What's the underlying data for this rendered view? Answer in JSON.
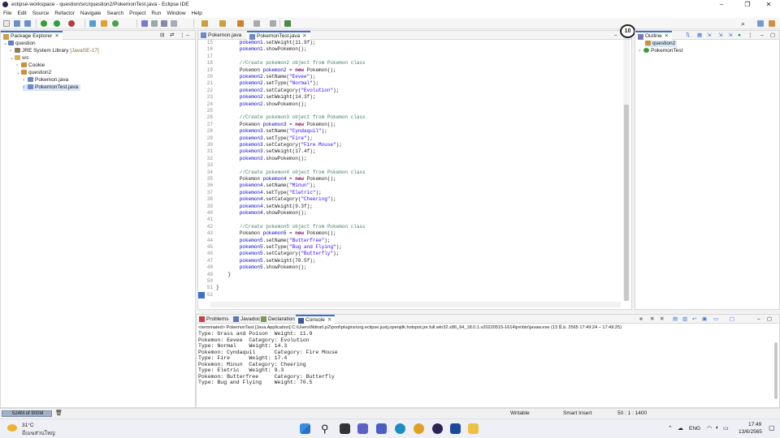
{
  "window": {
    "title": "eclipse-workspace - question/src/question2/PokemonTest.java - Eclipse IDE"
  },
  "menu": [
    "File",
    "Edit",
    "Source",
    "Refactor",
    "Navigate",
    "Search",
    "Project",
    "Run",
    "Window",
    "Help"
  ],
  "package_explorer": {
    "title": "Package Explorer",
    "items": [
      {
        "label": "question"
      },
      {
        "label": "JRE System Library",
        "suffix": "[JavaSE-17]"
      },
      {
        "label": "src"
      },
      {
        "label": "Cookie"
      },
      {
        "label": "question2"
      },
      {
        "label": "Pokemon.java"
      },
      {
        "label": "PokemonTest.java"
      }
    ]
  },
  "editor": {
    "tabs": [
      {
        "label": "Pokemon.java"
      },
      {
        "label": "PokemonTest.java"
      }
    ],
    "badge": "10",
    "lines": [
      {
        "n": "15",
        "t": "        pokemon1.setWeight(11.9f);"
      },
      {
        "n": "16",
        "t": "        pokemon1.showPokemon();"
      },
      {
        "n": "17",
        "t": ""
      },
      {
        "n": "18",
        "t": "        //Create pokemon2 object from Pokemon class"
      },
      {
        "n": "19",
        "t": "        Pokemon pokemon2 = new Pokemon();"
      },
      {
        "n": "20",
        "t": "        pokemon2.setName(\"Eevee\");"
      },
      {
        "n": "21",
        "t": "        pokemon2.setType(\"Normal\");"
      },
      {
        "n": "22",
        "t": "        pokemon2.setCategory(\"Evolution\");"
      },
      {
        "n": "23",
        "t": "        pokemon2.setWeight(14.3f);"
      },
      {
        "n": "24",
        "t": "        pokemon2.showPokemon();"
      },
      {
        "n": "25",
        "t": ""
      },
      {
        "n": "26",
        "t": "        //Create pokemon3 object from Pokemon class"
      },
      {
        "n": "27",
        "t": "        Pokemon pokemon3 = new Pokemon();"
      },
      {
        "n": "28",
        "t": "        pokemon3.setName(\"Cyndaquil\");"
      },
      {
        "n": "29",
        "t": "        pokemon3.setType(\"Fire\");"
      },
      {
        "n": "30",
        "t": "        pokemon3.setCategory(\"Fire Mouse\");"
      },
      {
        "n": "31",
        "t": "        pokemon3.setWeight(17.4f);"
      },
      {
        "n": "32",
        "t": "        pokemon3.showPokemon();"
      },
      {
        "n": "33",
        "t": ""
      },
      {
        "n": "34",
        "t": "        //Create pokemon4 object from Pokemon class"
      },
      {
        "n": "35",
        "t": "        Pokemon pokemon4 = new Pokemon();"
      },
      {
        "n": "36",
        "t": "        pokemon4.setName(\"Minun\");"
      },
      {
        "n": "37",
        "t": "        pokemon4.setType(\"Eletric\");"
      },
      {
        "n": "38",
        "t": "        pokemon4.setCategory(\"Cheering\");"
      },
      {
        "n": "39",
        "t": "        pokemon4.setWeight(9.3f);"
      },
      {
        "n": "40",
        "t": "        pokemon4.showPokemon();"
      },
      {
        "n": "41",
        "t": ""
      },
      {
        "n": "42",
        "t": "        //Create pokemon5 object from Pokemon class"
      },
      {
        "n": "43",
        "t": "        Pokemon pokemon5 = new Pokemon();"
      },
      {
        "n": "44",
        "t": "        pokemon5.setName(\"Butterfree\");"
      },
      {
        "n": "45",
        "t": "        pokemon5.setType(\"Bug and Flying\");"
      },
      {
        "n": "46",
        "t": "        pokemon5.setCategory(\"Butterfly\");"
      },
      {
        "n": "47",
        "t": "        pokemon5.setWeight(70.5f);"
      },
      {
        "n": "48",
        "t": "        pokemon5.showPokemon();"
      },
      {
        "n": "49",
        "t": "    }"
      },
      {
        "n": "50",
        "t": ""
      },
      {
        "n": "51",
        "t": "}"
      },
      {
        "n": "52",
        "t": ""
      }
    ]
  },
  "outline": {
    "title": "Outline",
    "items": [
      {
        "label": "question2"
      },
      {
        "label": "PokemonTest"
      }
    ]
  },
  "bottom": {
    "tabs": [
      {
        "label": "Problems"
      },
      {
        "label": "Javadoc"
      },
      {
        "label": "Declaration"
      },
      {
        "label": "Console"
      }
    ],
    "terminated": "<terminated> PokemonTest [Java Application] C:\\Users\\Nitirat\\.p2\\pool\\plugins\\org.eclipse.justj.openjdk.hotspot.jre.full.win32.x86_64_18.0.1.v20220515-1614\\jre\\bin\\javaw.exe  (13 มิ.ย. 2565 17:49:24 – 17:49:25)",
    "console": [
      "Type: Grass and Poison  Weight: 11.9",
      "Pokemon: Eevee  Category: Evolution",
      "Type: Normal    Weight: 14.3",
      "Pokemon: Cyndaquil      Category: Fire Mouse",
      "Type: Fire      Weight: 17.4",
      "Pokemon: Minun  Category: Cheering",
      "Type: Eletric   Weight: 9.3",
      "Pokemon: Butterfree     Category: Butterfly",
      "Type: Bug and Flying    Weight: 70.5"
    ]
  },
  "status": {
    "heap": "524M of 900M",
    "writable": "Writable",
    "insert_mode": "Smart Insert",
    "position": "50 : 1 : 1400"
  },
  "taskbar": {
    "temp": "31°C",
    "weather": "มีเมฆส่วนใหญ่",
    "lang": "ENG",
    "time": "17:49",
    "date": "13/6/2565"
  }
}
